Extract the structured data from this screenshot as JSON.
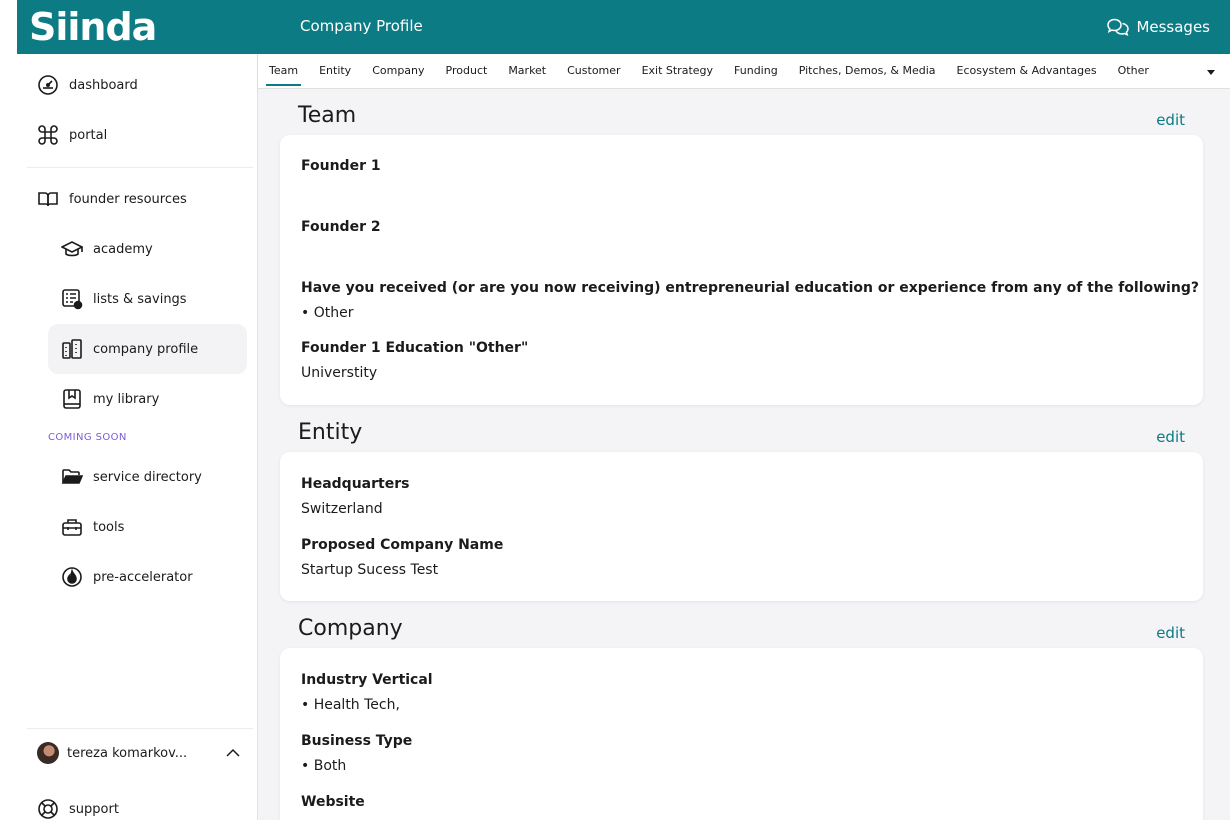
{
  "app": {
    "logo": "Siinda",
    "page_heading": "Company Profile",
    "messages_label": "Messages"
  },
  "sidebar": {
    "items": [
      {
        "label": "dashboard"
      },
      {
        "label": "portal"
      },
      {
        "label": "founder resources"
      },
      {
        "label": "academy"
      },
      {
        "label": "lists & savings"
      },
      {
        "label": "company profile"
      },
      {
        "label": "my library"
      },
      {
        "label": "service directory"
      },
      {
        "label": "tools"
      },
      {
        "label": "pre-accelerator"
      }
    ],
    "coming_soon": "COMING SOON",
    "user_name": "tereza komarkov...",
    "support": "support"
  },
  "tabs": [
    "Team",
    "Entity",
    "Company",
    "Product",
    "Market",
    "Customer",
    "Exit Strategy",
    "Funding",
    "Pitches, Demos, & Media",
    "Ecosystem & Advantages",
    "Other"
  ],
  "sections": {
    "team": {
      "title": "Team",
      "edit": "edit",
      "founder1": "Founder 1",
      "founder2": "Founder 2",
      "education_q": "Have you received (or are you now receiving) entrepreneurial education or experience from any of the following?",
      "education_a": "• Other",
      "other_q": "Founder 1 Education \"Other\"",
      "other_a": "Universtity"
    },
    "entity": {
      "title": "Entity",
      "edit": "edit",
      "hq_q": "Headquarters",
      "hq_a": "Switzerland",
      "name_q": "Proposed Company Name",
      "name_a": "Startup Sucess Test"
    },
    "company": {
      "title": "Company",
      "edit": "edit",
      "industry_q": "Industry Vertical",
      "industry_a": "• Health Tech,",
      "btype_q": "Business Type",
      "btype_a": "• Both",
      "website_q": "Website"
    }
  },
  "colors": {
    "brand": "#0c7b84",
    "coming_soon": "#7b5cd6",
    "content_bg": "#f4f3f6"
  }
}
